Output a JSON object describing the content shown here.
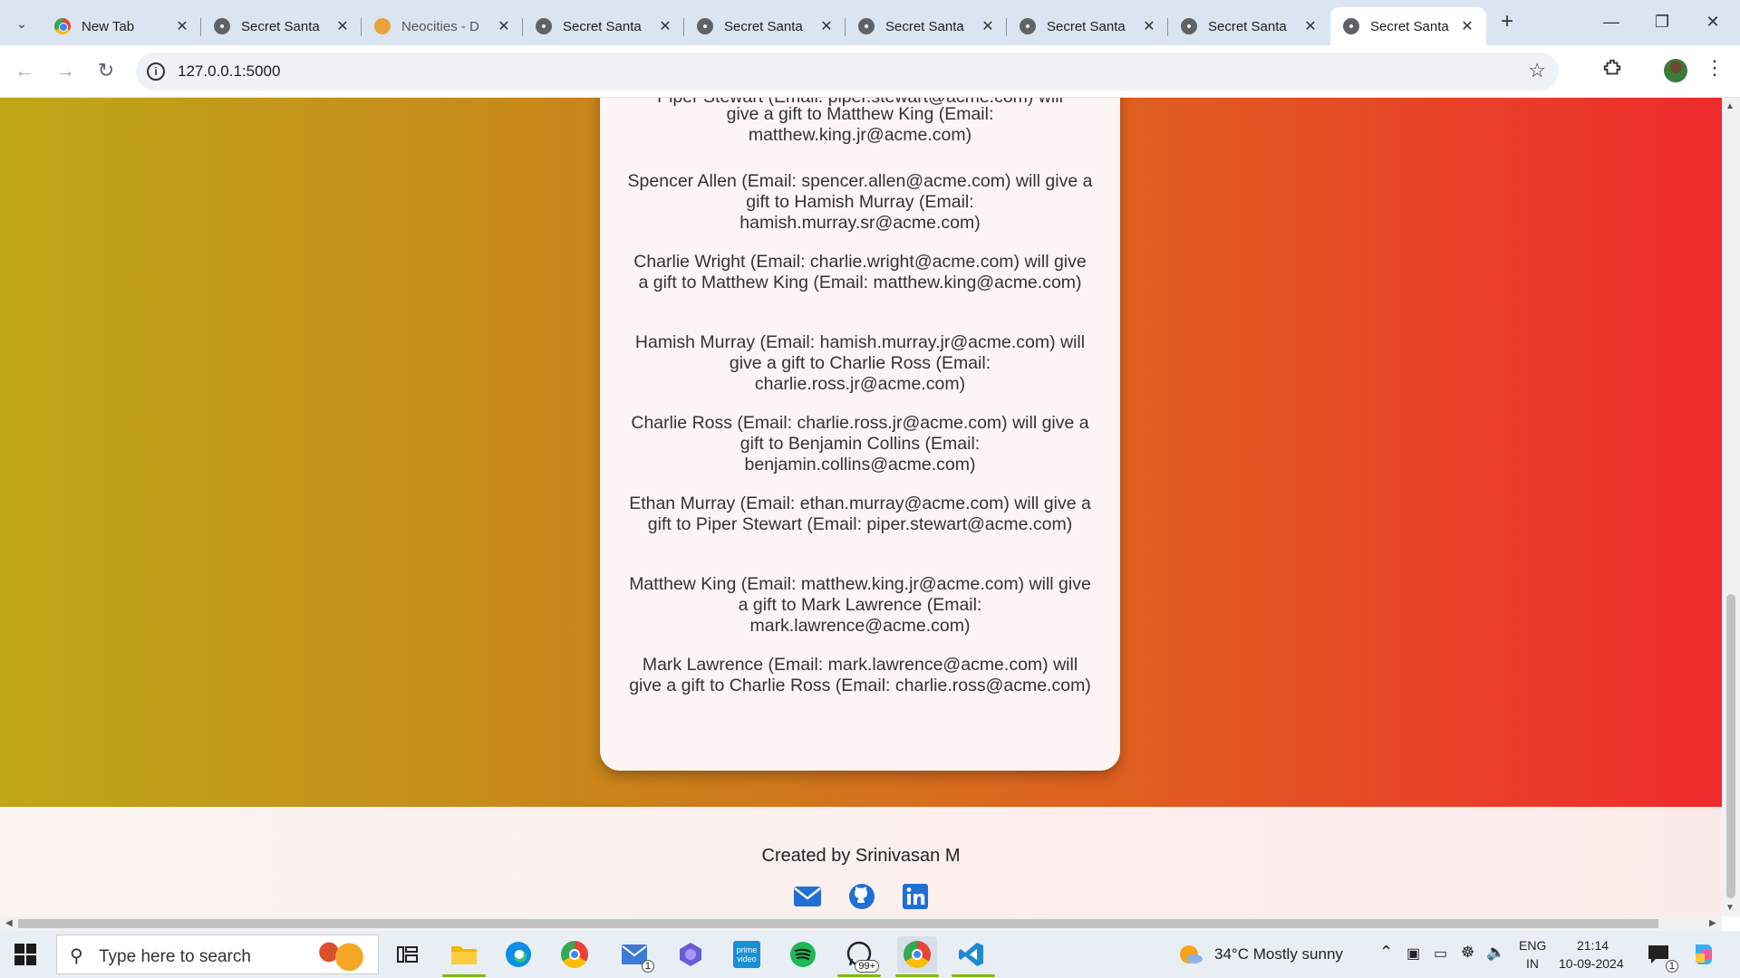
{
  "browser": {
    "tabs": [
      {
        "title": "New Tab",
        "icon": "chrome-icon"
      },
      {
        "title": "Secret Santa",
        "icon": "globe-icon"
      },
      {
        "title": "Neocities - D",
        "icon": "neocities-cat-icon"
      },
      {
        "title": "Secret Santa",
        "icon": "globe-icon"
      },
      {
        "title": "Secret Santa",
        "icon": "globe-icon"
      },
      {
        "title": "Secret Santa",
        "icon": "globe-icon"
      },
      {
        "title": "Secret Santa",
        "icon": "globe-icon"
      },
      {
        "title": "Secret Santa",
        "icon": "globe-icon"
      },
      {
        "title": "Secret Santa",
        "icon": "globe-icon",
        "active": true
      }
    ],
    "url": "127.0.0.1:5000"
  },
  "page": {
    "partial_first": "Piper Stewart (Email: piper.stewart@acme.com) will",
    "assignments": [
      "give a gift to Matthew King (Email: matthew.king.jr@acme.com)",
      "Spencer Allen (Email: spencer.allen@acme.com) will give a gift to Hamish Murray (Email: hamish.murray.sr@acme.com)",
      "Charlie Wright (Email: charlie.wright@acme.com) will give a gift to Matthew King (Email: matthew.king@acme.com)",
      "Hamish Murray (Email: hamish.murray.jr@acme.com) will give a gift to Charlie Ross (Email: charlie.ross.jr@acme.com)",
      "Charlie Ross (Email: charlie.ross.jr@acme.com) will give a gift to Benjamin Collins (Email: benjamin.collins@acme.com)",
      "Ethan Murray (Email: ethan.murray@acme.com) will give a gift to Piper Stewart (Email: piper.stewart@acme.com)",
      "Matthew King (Email: matthew.king.jr@acme.com) will give a gift to Mark Lawrence (Email: mark.lawrence@acme.com)",
      "Mark Lawrence (Email: mark.lawrence@acme.com) will give a gift to Charlie Ross (Email: charlie.ross@acme.com)"
    ],
    "footer": {
      "credit": "Created by Srinivasan M",
      "links": [
        "email-icon",
        "github-icon",
        "linkedin-icon"
      ]
    },
    "colors": {
      "gradient_start": "#bfa719",
      "gradient_end": "#ee2a2d",
      "card": "#fdf5f3",
      "link_icon": "#1f6fd6"
    }
  },
  "taskbar": {
    "search_placeholder": "Type here to search",
    "mail_badge": "1",
    "whatsapp_badge": "99+",
    "weather": "34°C  Mostly sunny",
    "lang_top": "ENG",
    "lang_bottom": "IN",
    "time": "21:14",
    "date": "10-09-2024",
    "notification_count": "1"
  }
}
